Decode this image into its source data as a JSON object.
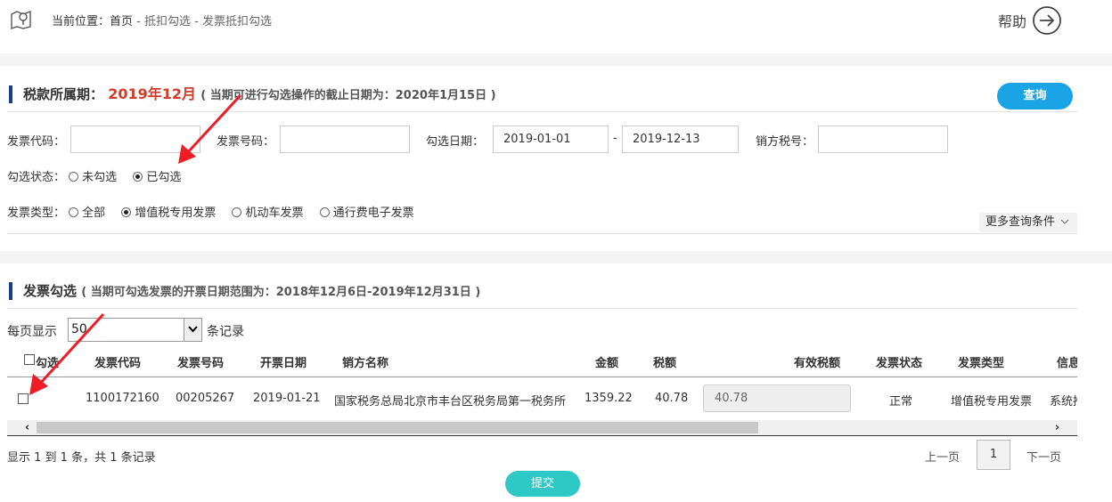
{
  "breadcrumb": {
    "prefix": "当前位置：",
    "home": "首页",
    "sep1": " - ",
    "level1": "抵扣勾选",
    "sep2": " - ",
    "current": "发票抵扣勾选"
  },
  "help": {
    "label": "帮助"
  },
  "filter": {
    "title": "税款所属期：",
    "period": "2019年12月",
    "deadline_note": "( 当期可进行勾选操作的截止日期为：2020年1月15日 )",
    "query_button": "查询",
    "invoice_code_label": "发票代码：",
    "invoice_code_value": "",
    "invoice_no_label": "发票号码：",
    "invoice_no_value": "",
    "select_date_label": "勾选日期：",
    "date_from": "2019-01-01",
    "date_sep": "-",
    "date_to": "2019-12-13",
    "seller_tax_label": "销方税号：",
    "seller_tax_value": "",
    "status_label": "勾选状态：",
    "status_options": [
      "未勾选",
      "已勾选"
    ],
    "status_selected": "已勾选",
    "type_label": "发票类型：",
    "type_options": [
      "全部",
      "增值税专用发票",
      "机动车发票",
      "通行费电子发票"
    ],
    "type_selected": "增值税专用发票",
    "more_conditions": "更多查询条件"
  },
  "list": {
    "title": "发票勾选",
    "range_note": "( 当期可勾选发票的开票日期范围为：2018年12月6日-2019年12月31日 )",
    "page_size_prefix": "每页显示",
    "page_size": "50",
    "page_size_suffix": "条记录",
    "columns": [
      "勾选",
      "发票代码",
      "发票号码",
      "开票日期",
      "销方名称",
      "金额",
      "税额",
      "有效税额",
      "发票状态",
      "发票类型",
      "信息"
    ],
    "rows": [
      {
        "invoice_code": "1100172160",
        "invoice_no": "00205267",
        "issue_date": "2019-01-21",
        "seller_name": "国家税务总局北京市丰台区税务局第一税务所",
        "amount": "1359.22",
        "tax": "40.78",
        "effective_tax": "40.78",
        "status": "正常",
        "type": "增值税专用发票",
        "info": "系统推"
      }
    ],
    "summary": "显示 1 到 1 条，共 1 条记录",
    "prev": "上一页",
    "current_page": "1",
    "next": "下一页",
    "submit": "提交"
  },
  "colors": {
    "accent_blue": "#1ba4e5",
    "submit_teal": "#2ec8c6",
    "period_red": "#d23b2a",
    "annotation_arrow": "#ee1c24"
  }
}
